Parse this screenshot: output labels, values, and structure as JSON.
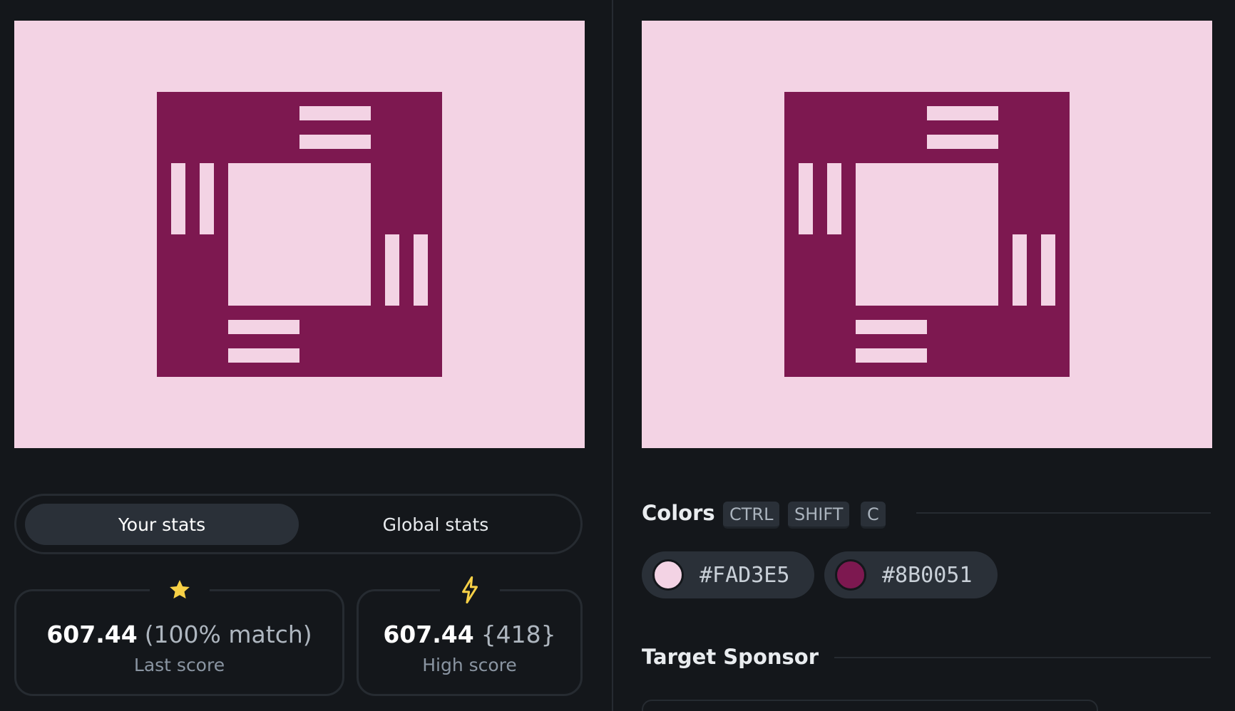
{
  "colors": {
    "background": "#FAD3E5",
    "foreground": "#8B0051",
    "page_bg": "#14171b",
    "star": "#f7d046",
    "bolt": "#f7d046"
  },
  "previews": [
    {
      "name": "your-output"
    },
    {
      "name": "target"
    }
  ],
  "stats_tabs": {
    "active": "Your stats",
    "inactive": "Global stats"
  },
  "last_score": {
    "icon": "star-icon",
    "value": "607.44",
    "extra": "(100% match)",
    "label": "Last score"
  },
  "high_score": {
    "icon": "bolt-icon",
    "value": "607.44",
    "extra": "{418}",
    "label": "High score"
  },
  "colors_section": {
    "title": "Colors",
    "shortcut": [
      "CTRL",
      "SHIFT",
      "C"
    ],
    "swatches": [
      {
        "hex": "#FAD3E5",
        "color": "#FAD3E5"
      },
      {
        "hex": "#8B0051",
        "color": "#7d1850"
      }
    ]
  },
  "sponsor_section": {
    "title": "Target Sponsor"
  }
}
